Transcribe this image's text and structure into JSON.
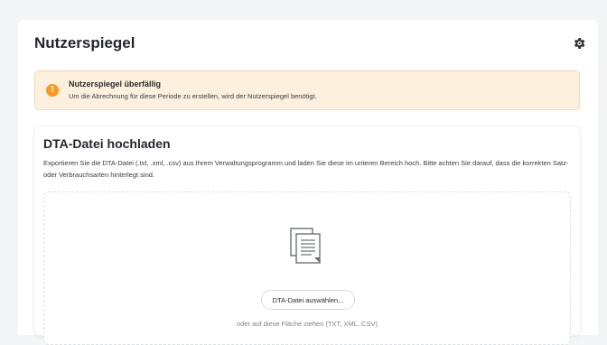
{
  "header": {
    "title": "Nutzerspiegel",
    "settings_icon": "gear-icon"
  },
  "alert": {
    "icon": "exclamation-icon",
    "color": "#f59a23",
    "title": "Nutzerspiegel überfällig",
    "message": "Um die Abrechnung für diese Periode zu erstellen, wird der Nutzerspiegel benötigt."
  },
  "upload": {
    "title": "DTA-Datei hochladen",
    "description": "Exportieren Sie die DTA-Datei (.txt, .xml, .csv) aus Ihrem Verwaltungsprogramm und laden Sie diese im unteren Bereich hoch. Bitte achten Sie darauf, dass die korrekten Satz- oder Verbrauchsarten hinterlegt sind.",
    "file_icon": "document-stack-icon",
    "button_label": "DTA-Datei auswählen...",
    "drop_hint": "oder auf diese Fläche ziehen (TXT, XML, CSV)"
  }
}
